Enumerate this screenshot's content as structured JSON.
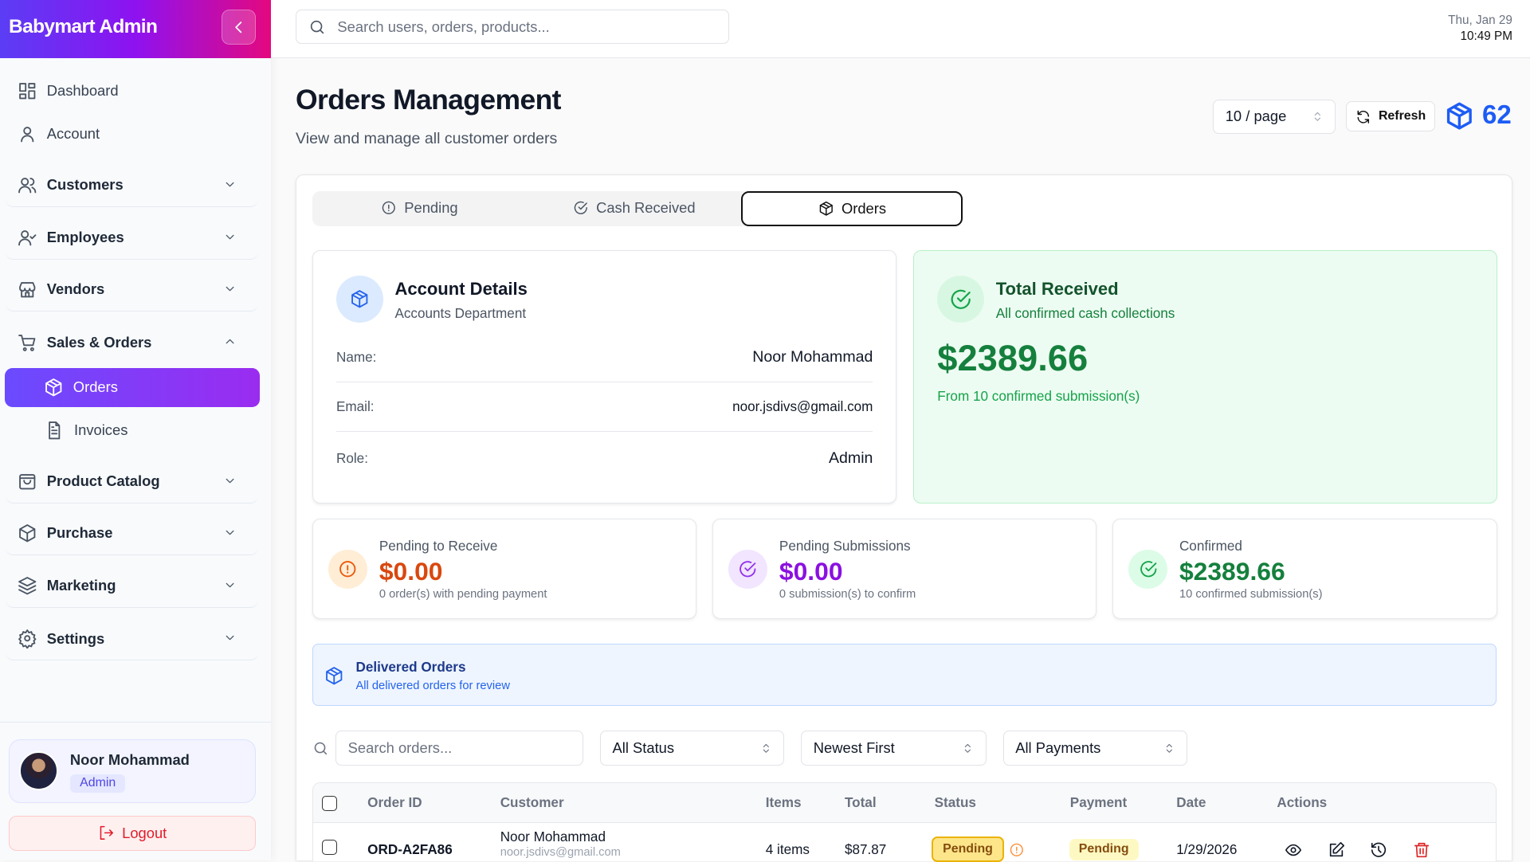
{
  "app": {
    "title": "Babymart Admin"
  },
  "sidebar": {
    "items": [
      {
        "label": "Dashboard",
        "icon": "grid-icon"
      },
      {
        "label": "Account",
        "icon": "user-icon"
      },
      {
        "label": "Customers",
        "icon": "users-icon"
      },
      {
        "label": "Employees",
        "icon": "user-check-icon"
      },
      {
        "label": "Vendors",
        "icon": "store-icon"
      },
      {
        "label": "Sales & Orders",
        "icon": "cart-icon"
      },
      {
        "label": "Orders",
        "icon": "box-icon"
      },
      {
        "label": "Invoices",
        "icon": "file-icon"
      },
      {
        "label": "Product Catalog",
        "icon": "bag-icon"
      },
      {
        "label": "Purchase",
        "icon": "package-icon"
      },
      {
        "label": "Marketing",
        "icon": "layers-icon"
      },
      {
        "label": "Settings",
        "icon": "gear-icon"
      }
    ],
    "user": {
      "name": "Noor Mohammad",
      "role": "Admin"
    },
    "logout": "Logout"
  },
  "topbar": {
    "search_placeholder": "Search users, orders, products...",
    "date": "Thu, Jan 29",
    "time": "10:49 PM"
  },
  "page": {
    "title": "Orders Management",
    "subtitle": "View and manage all customer orders",
    "per_page": "10 / page",
    "refresh": "Refresh",
    "count": "62"
  },
  "tabs": [
    {
      "label": "Pending"
    },
    {
      "label": "Cash Received"
    },
    {
      "label": "Orders"
    }
  ],
  "account": {
    "title": "Account Details",
    "subtitle": "Accounts Department",
    "name_label": "Name:",
    "name": "Noor Mohammad",
    "email_label": "Email:",
    "email": "noor.jsdivs@gmail.com",
    "role_label": "Role:",
    "role": "Admin"
  },
  "total": {
    "title": "Total Received",
    "subtitle": "All confirmed cash collections",
    "amount": "$2389.66",
    "note": "From 10 confirmed submission(s)"
  },
  "stats": [
    {
      "label": "Pending to Receive",
      "value": "$0.00",
      "note": "0 order(s) with pending payment",
      "color": "#d9480f"
    },
    {
      "label": "Pending Submissions",
      "value": "$0.00",
      "note": "0 submission(s) to confirm",
      "color": "#8b10e0"
    },
    {
      "label": "Confirmed",
      "value": "$2389.66",
      "note": "10 confirmed submission(s)",
      "color": "#15803d"
    }
  ],
  "delivered": {
    "title": "Delivered Orders",
    "subtitle": "All delivered orders for review"
  },
  "filters": {
    "search_placeholder": "Search orders...",
    "status": "All Status",
    "sort": "Newest First",
    "payment": "All Payments"
  },
  "table": {
    "headers": [
      "Order ID",
      "Customer",
      "Items",
      "Total",
      "Status",
      "Payment",
      "Date",
      "Actions"
    ],
    "rows": [
      {
        "id": "ORD-A2FA86",
        "customer": "Noor Mohammad",
        "email": "noor.jsdivs@gmail.com",
        "items": "4 items",
        "total": "$87.87",
        "status": "Pending",
        "payment": "Pending",
        "date": "1/29/2026"
      }
    ]
  }
}
